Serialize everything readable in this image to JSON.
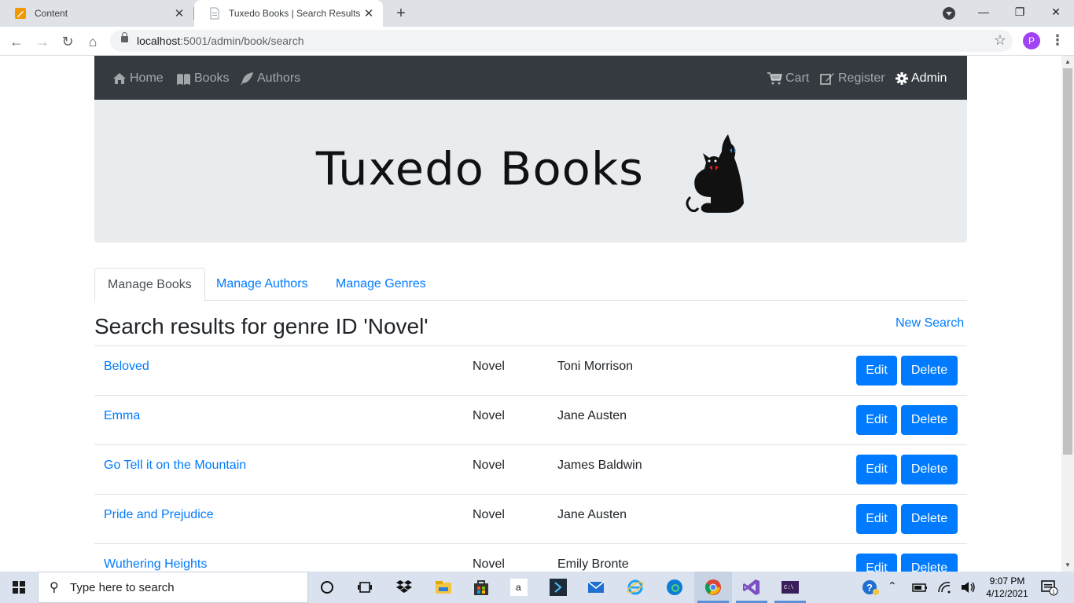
{
  "browser": {
    "tabs": [
      {
        "title": "Content",
        "favicon": "pencil-note-icon"
      },
      {
        "title": "Tuxedo Books | Search Results",
        "favicon": "page-icon"
      }
    ],
    "url_host": "localhost",
    "url_rest": ":5001/admin/book/search",
    "profile_initial": "P"
  },
  "site": {
    "nav_left": [
      {
        "label": "Home",
        "icon": "home-icon"
      },
      {
        "label": "Books",
        "icon": "book-icon"
      },
      {
        "label": "Authors",
        "icon": "feather-icon"
      }
    ],
    "nav_right": [
      {
        "label": "Cart",
        "icon": "cart-icon"
      },
      {
        "label": "Register",
        "icon": "edit-icon"
      },
      {
        "label": "Admin",
        "icon": "gear-icon"
      }
    ],
    "logo_text": "Tuxedo Books",
    "admin_tabs": [
      "Manage Books",
      "Manage Authors",
      "Manage Genres"
    ],
    "active_tab": "Manage Books",
    "heading": "Search results for genre ID 'Novel'",
    "new_search": "New Search",
    "edit_label": "Edit",
    "delete_label": "Delete",
    "results": [
      {
        "title": "Beloved",
        "genre": "Novel",
        "author": "Toni Morrison"
      },
      {
        "title": "Emma",
        "genre": "Novel",
        "author": "Jane Austen"
      },
      {
        "title": "Go Tell it on the Mountain",
        "genre": "Novel",
        "author": "James Baldwin"
      },
      {
        "title": "Pride and Prejudice",
        "genre": "Novel",
        "author": "Jane Austen"
      },
      {
        "title": "Wuthering Heights",
        "genre": "Novel",
        "author": "Emily Bronte"
      }
    ],
    "colors": {
      "navbar": "#343a40",
      "link": "#007bff",
      "banner": "#e9ecef"
    }
  },
  "taskbar": {
    "search_placeholder": "Type here to search",
    "time": "9:07 PM",
    "date": "4/12/2021"
  }
}
